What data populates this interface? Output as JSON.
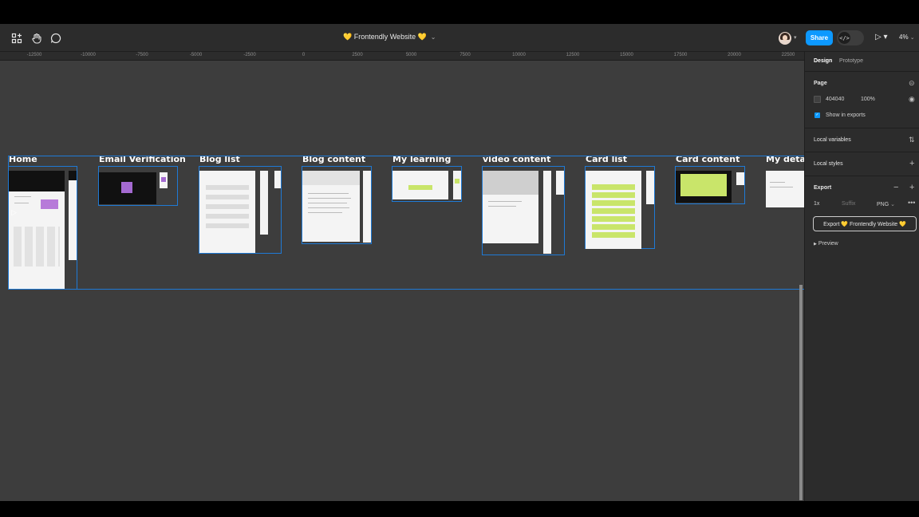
{
  "toolbar": {
    "file_title": "💛 Frontendly Website 💛",
    "share_label": "Share",
    "dev_mode_icon": "</>",
    "play_icon": "▷ ▾",
    "zoom": "4%",
    "icons": [
      "frames-icon",
      "hand-icon",
      "comment-icon",
      "play-icon"
    ]
  },
  "ruler": {
    "ticks": [
      "-12500",
      "-10000",
      "-7500",
      "-5000",
      "-2500",
      "0",
      "2500",
      "5000",
      "7500",
      "10000",
      "12500",
      "15000",
      "17500",
      "20000",
      "22500"
    ]
  },
  "canvas": {
    "background": "#3d3d3d",
    "selection_color": "#1f7ad6",
    "frames": [
      "Home",
      "Email Verification",
      "Blog list",
      "Blog content",
      "My learning",
      "video content",
      "Card list",
      "Card content",
      "My detai"
    ]
  },
  "panel": {
    "tabs": [
      "Design",
      "Prototype"
    ],
    "page": {
      "heading": "Page",
      "color_hex": "404040",
      "opacity": "100%",
      "show_in_exports": "Show in exports"
    },
    "local_variables": "Local variables",
    "local_styles": "Local styles",
    "export": {
      "heading": "Export",
      "scale": "1x",
      "suffix_placeholder": "Suffix",
      "format": "PNG",
      "button_label": "Export 💛 Frontendly Website 💛",
      "preview": "Preview"
    }
  },
  "colors": {
    "accent": "#0d99ff",
    "panel": "#2c2c2c",
    "canvas": "#3d3d3d"
  }
}
